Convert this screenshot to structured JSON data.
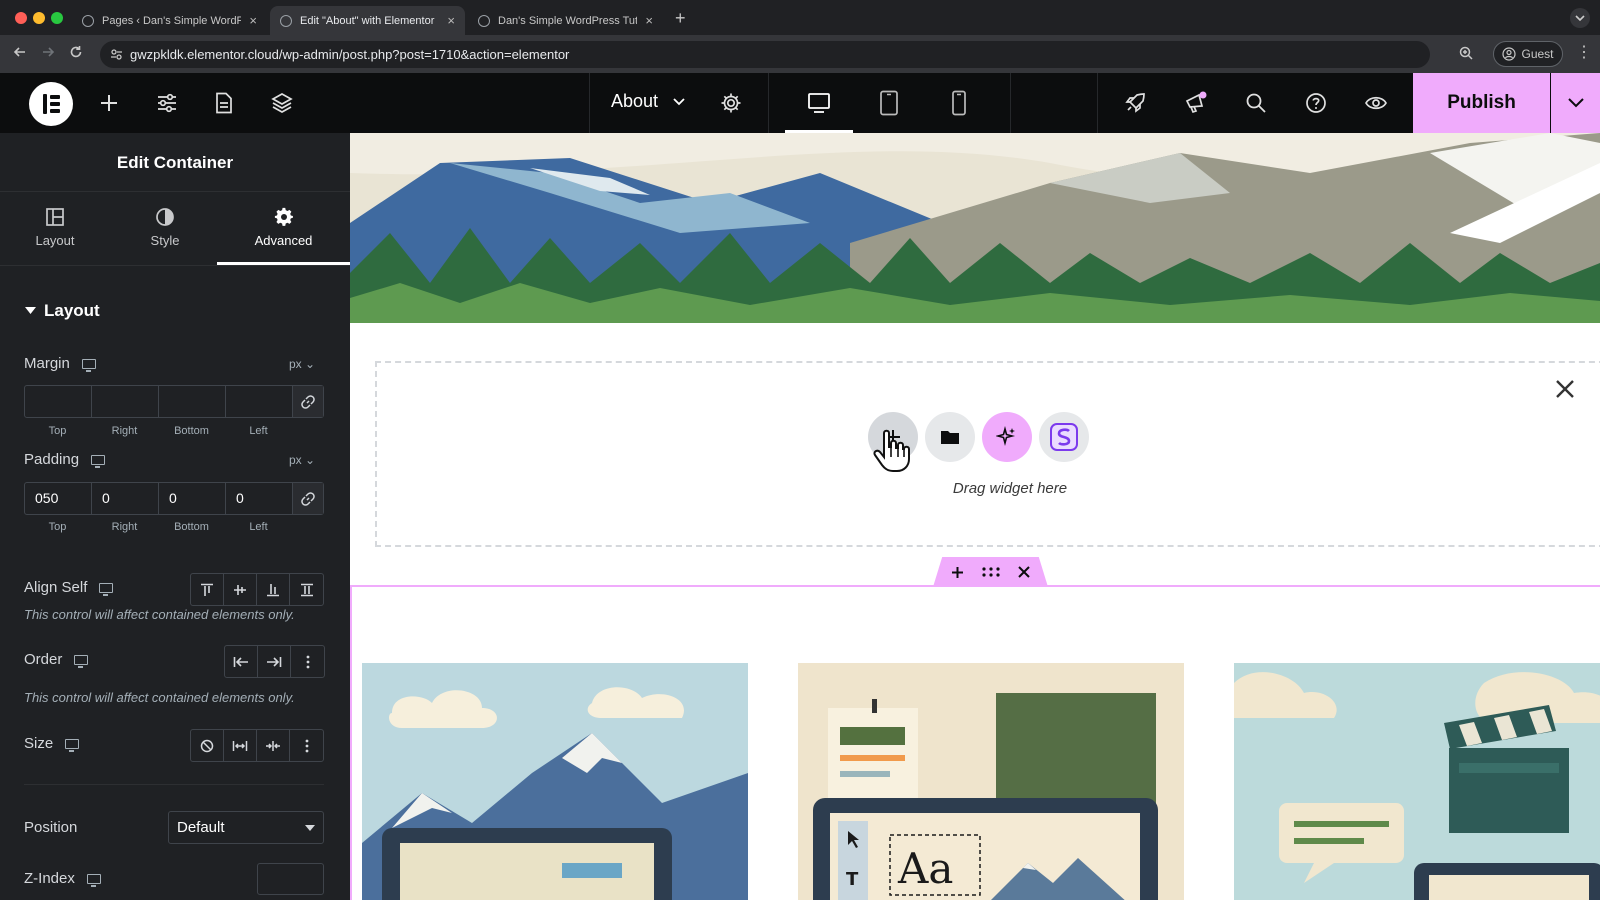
{
  "browser": {
    "tabs": [
      {
        "label": "Pages ‹ Dan's Simple WordPr"
      },
      {
        "label": "Edit \"About\" with Elementor"
      },
      {
        "label": "Dan's Simple WordPress Tuto"
      }
    ],
    "url": "gwzpkldk.elementor.cloud/wp-admin/post.php?post=1710&action=elementor",
    "profile_label": "Guest"
  },
  "topbar": {
    "page_name": "About",
    "publish_label": "Publish",
    "colors": {
      "accent": "#f0abfc",
      "bar": "#0c0d0e"
    }
  },
  "panel": {
    "title": "Edit Container",
    "tabs": [
      {
        "label": "Layout",
        "icon": "layout-columns-icon"
      },
      {
        "label": "Style",
        "icon": "half-circle-icon"
      },
      {
        "label": "Advanced",
        "icon": "gear-icon",
        "active": true
      }
    ],
    "section_title": "Layout",
    "margin": {
      "label": "Margin",
      "unit": "px",
      "values": [
        "",
        "",
        "",
        ""
      ],
      "sides": [
        "Top",
        "Right",
        "Bottom",
        "Left"
      ]
    },
    "padding": {
      "label": "Padding",
      "unit": "px",
      "values": [
        "050",
        "0",
        "0",
        "0"
      ],
      "sides": [
        "Top",
        "Right",
        "Bottom",
        "Left"
      ]
    },
    "align_self": {
      "label": "Align Self",
      "hint": "This control will affect contained elements only."
    },
    "order": {
      "label": "Order",
      "hint": "This control will affect contained elements only."
    },
    "size": {
      "label": "Size"
    },
    "position": {
      "label": "Position",
      "value": "Default"
    },
    "zindex": {
      "label": "Z-Index",
      "value": ""
    }
  },
  "canvas": {
    "dropzone_text": "Drag widget here"
  }
}
